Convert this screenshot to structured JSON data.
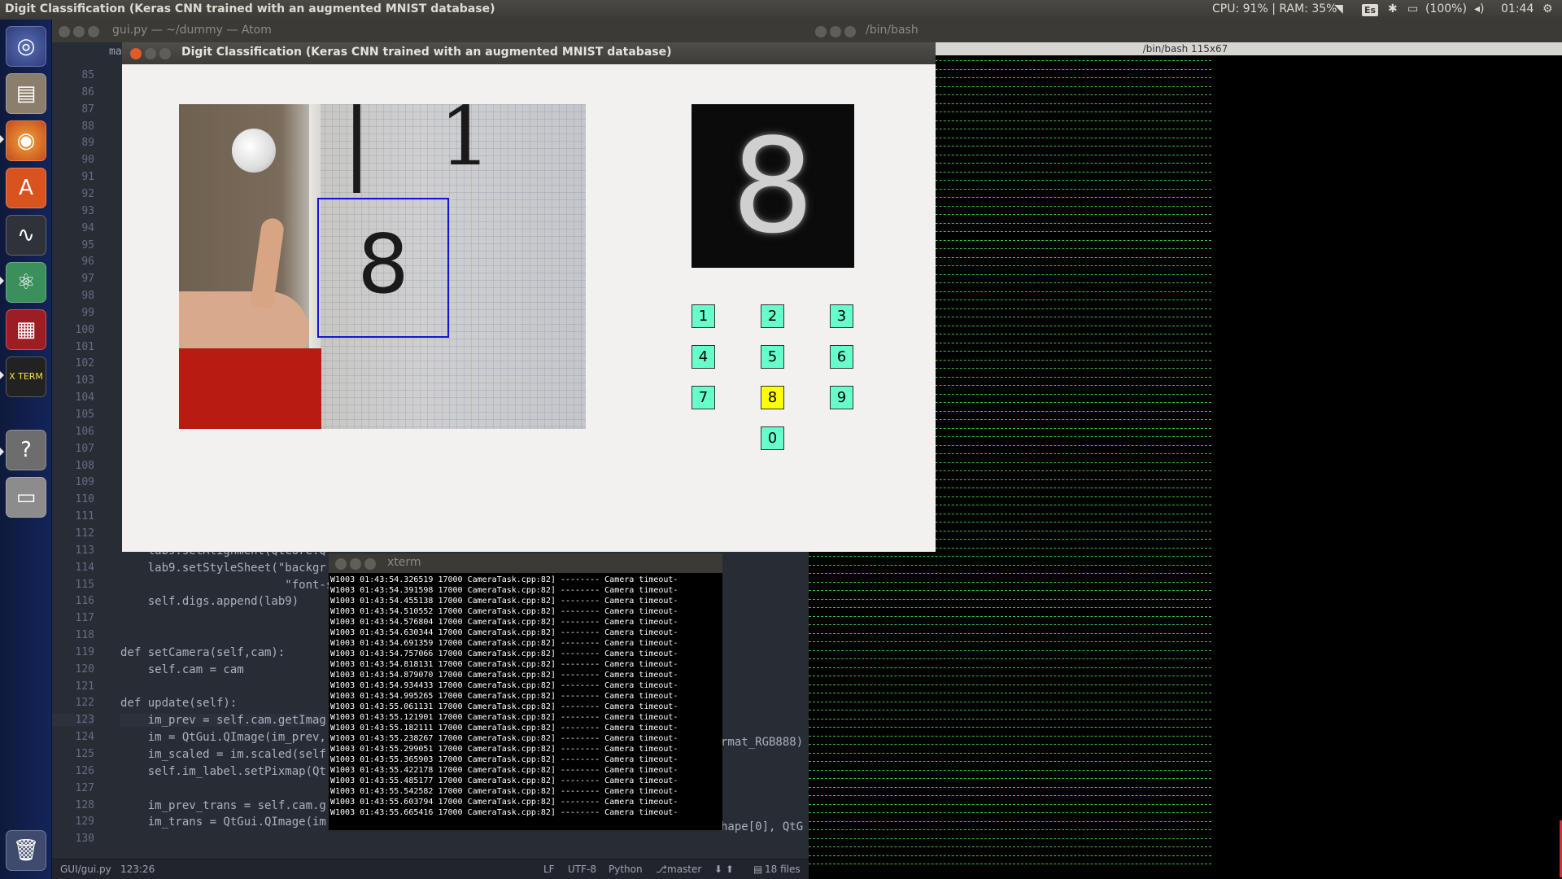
{
  "topbar": {
    "title": "Digit Classification (Keras CNN trained with an augmented MNIST database)",
    "cpu_ram": "CPU: 91% | RAM: 35%",
    "keyboard": "Es",
    "battery": "(100%)",
    "clock": "01:44"
  },
  "launcher": {
    "items": [
      "ubuntu-dash-icon",
      "files-icon",
      "firefox-icon",
      "software-center-icon",
      "system-monitor-icon",
      "atom-icon",
      "workspace-switcher-icon",
      "xterm-icon",
      "help-icon",
      "drive-icon",
      "trash-icon"
    ],
    "xterm_label": "X TERM"
  },
  "atom": {
    "window_title": "gui.py — ~/dummy — Atom",
    "tab_label": "ma",
    "lines": [
      {
        "n": "85",
        "code": ""
      },
      {
        "n": "86",
        "code": ""
      },
      {
        "n": "87",
        "code": ""
      },
      {
        "n": "88",
        "code": ""
      },
      {
        "n": "89",
        "code": ""
      },
      {
        "n": "90",
        "code": ""
      },
      {
        "n": "91",
        "code": ""
      },
      {
        "n": "92",
        "code": ""
      },
      {
        "n": "93",
        "code": ""
      },
      {
        "n": "94",
        "code": ""
      },
      {
        "n": "95",
        "code": ""
      },
      {
        "n": "96",
        "code": ""
      },
      {
        "n": "97",
        "code": ""
      },
      {
        "n": "98",
        "code": ""
      },
      {
        "n": "99",
        "code": ""
      },
      {
        "n": "100",
        "code": ""
      },
      {
        "n": "101",
        "code": ""
      },
      {
        "n": "102",
        "code": ""
      },
      {
        "n": "103",
        "code": ""
      },
      {
        "n": "104",
        "code": ""
      },
      {
        "n": "105",
        "code": ""
      },
      {
        "n": "106",
        "code": ""
      },
      {
        "n": "107",
        "code": ""
      },
      {
        "n": "108",
        "code": ""
      },
      {
        "n": "109",
        "code": ""
      },
      {
        "n": "110",
        "code": ""
      },
      {
        "n": "111",
        "code": ""
      },
      {
        "n": "112",
        "code": ""
      },
      {
        "n": "113",
        "code": "    lab9.setAlignment(QtCore.Q"
      },
      {
        "n": "114",
        "code": "    lab9.setStyleSheet(\"backgr"
      },
      {
        "n": "115",
        "code": "                        \"font-s"
      },
      {
        "n": "116",
        "code": "    self.digs.append(lab9)"
      },
      {
        "n": "117",
        "code": ""
      },
      {
        "n": "118",
        "code": ""
      },
      {
        "n": "119",
        "code": "def setCamera(self,cam):"
      },
      {
        "n": "120",
        "code": "    self.cam = cam"
      },
      {
        "n": "121",
        "code": ""
      },
      {
        "n": "122",
        "code": "def update(self):"
      },
      {
        "n": "123",
        "code": "    im_prev = self.cam.getImag"
      },
      {
        "n": "124",
        "code": "    im = QtGui.QImage(im_prev,"
      },
      {
        "n": "125",
        "code": "    im_scaled = im.scaled(self"
      },
      {
        "n": "126",
        "code": "    self.im_label.setPixmap(Qt"
      },
      {
        "n": "127",
        "code": ""
      },
      {
        "n": "128",
        "code": "    im_prev_trans = self.cam.g"
      },
      {
        "n": "129",
        "code": "    im_trans = QtGui.QImage(im"
      },
      {
        "n": "130",
        "code": ""
      }
    ],
    "overflow_text_124": "rmat_RGB888)",
    "overflow_text_129": "hape[0], QtG"
  },
  "status": {
    "path": "GUI/gui.py",
    "cursor": "123:26",
    "eol": "LF",
    "encoding": "UTF-8",
    "grammar": "Python",
    "branch": "master",
    "files": "18 files"
  },
  "bash": {
    "window_title": "/bin/bash",
    "subtitle": "/bin/bash 115x67"
  },
  "xterm": {
    "window_title": "xterm",
    "log": [
      "W1003 01:43:54.326519 17000 CameraTask.cpp:82] -------- Camera timeout-",
      "W1003 01:43:54.391598 17000 CameraTask.cpp:82] -------- Camera timeout-",
      "W1003 01:43:54.455138 17000 CameraTask.cpp:82] -------- Camera timeout-",
      "W1003 01:43:54.510552 17000 CameraTask.cpp:82] -------- Camera timeout-",
      "W1003 01:43:54.576804 17000 CameraTask.cpp:82] -------- Camera timeout-",
      "W1003 01:43:54.630344 17000 CameraTask.cpp:82] -------- Camera timeout-",
      "W1003 01:43:54.691359 17000 CameraTask.cpp:82] -------- Camera timeout-",
      "W1003 01:43:54.757066 17000 CameraTask.cpp:82] -------- Camera timeout-",
      "W1003 01:43:54.818131 17000 CameraTask.cpp:82] -------- Camera timeout-",
      "W1003 01:43:54.879070 17000 CameraTask.cpp:82] -------- Camera timeout-",
      "W1003 01:43:54.934433 17000 CameraTask.cpp:82] -------- Camera timeout-",
      "W1003 01:43:54.995265 17000 CameraTask.cpp:82] -------- Camera timeout-",
      "W1003 01:43:55.061131 17000 CameraTask.cpp:82] -------- Camera timeout-",
      "W1003 01:43:55.121901 17000 CameraTask.cpp:82] -------- Camera timeout-",
      "W1003 01:43:55.182111 17000 CameraTask.cpp:82] -------- Camera timeout-",
      "W1003 01:43:55.238267 17000 CameraTask.cpp:82] -------- Camera timeout-",
      "W1003 01:43:55.299051 17000 CameraTask.cpp:82] -------- Camera timeout-",
      "W1003 01:43:55.365903 17000 CameraTask.cpp:82] -------- Camera timeout-",
      "W1003 01:43:55.422178 17000 CameraTask.cpp:82] -------- Camera timeout-",
      "W1003 01:43:55.485177 17000 CameraTask.cpp:82] -------- Camera timeout-",
      "W1003 01:43:55.542582 17000 CameraTask.cpp:82] -------- Camera timeout-",
      "W1003 01:43:55.603794 17000 CameraTask.cpp:82] -------- Camera timeout-",
      "W1003 01:43:55.665416 17000 CameraTask.cpp:82] -------- Camera timeout-"
    ]
  },
  "dialog": {
    "title": "Digit Classification (Keras CNN trained with an augmented MNIST database)",
    "detected_digit": "8",
    "digits": [
      "1",
      "2",
      "3",
      "4",
      "5",
      "6",
      "7",
      "8",
      "9",
      "0"
    ],
    "active_digit": "8",
    "colors": {
      "digit_bg": "#66ffcc",
      "digit_active": "#ffff00",
      "roi_box": "#1414d8"
    }
  }
}
